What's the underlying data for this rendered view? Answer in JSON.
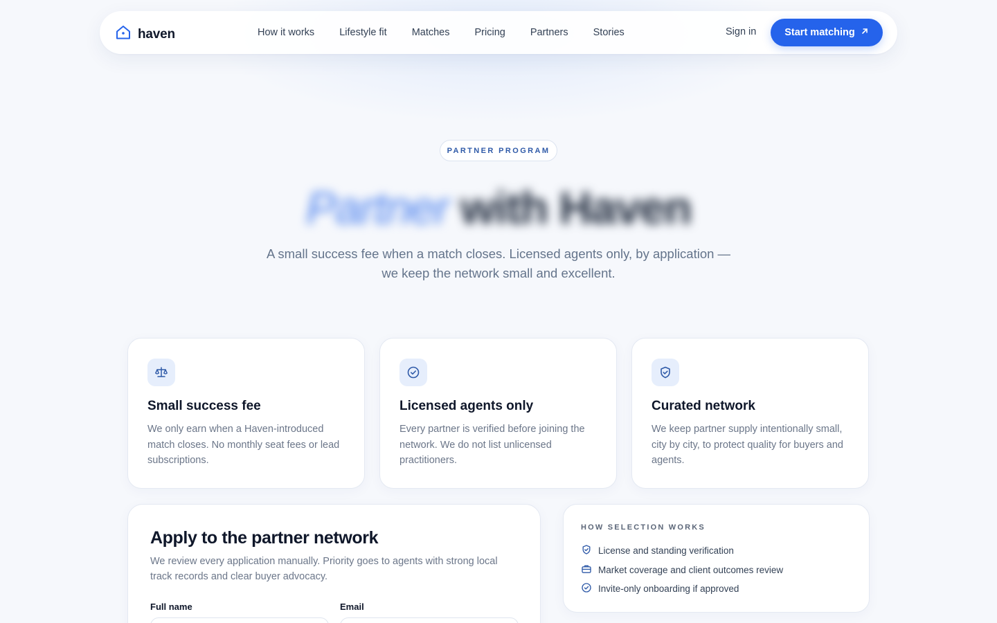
{
  "nav": {
    "brand": "haven",
    "links": [
      "How it works",
      "Lifestyle fit",
      "Matches",
      "Pricing",
      "Partners",
      "Stories"
    ],
    "signin": "Sign in",
    "cta": "Start matching"
  },
  "hero": {
    "eyebrow": "PARTNER PROGRAM",
    "title_accent": "Partner",
    "title_rest": "with Haven",
    "subtitle_line1": "A small success fee when a match closes. Licensed agents only, by application —",
    "subtitle_line2": "we keep the network small and excellent."
  },
  "features": [
    {
      "icon": "scale-icon",
      "title": "Small success fee",
      "body": "We only earn when a Haven-introduced match closes. No monthly seat fees or lead subscriptions."
    },
    {
      "icon": "badge-check-icon",
      "title": "Licensed agents only",
      "body": "Every partner is verified before joining the network. We do not list unlicensed practitioners."
    },
    {
      "icon": "shield-check-icon",
      "title": "Curated network",
      "body": "We keep partner supply intentionally small, city by city, to protect quality for buyers and agents."
    }
  ],
  "apply": {
    "title": "Apply to the partner network",
    "body": "We review every application manually. Priority goes to agents with strong local track records and clear buyer advocacy.",
    "full_name_label": "Full name",
    "email_label": "Email"
  },
  "selection": {
    "label": "HOW SELECTION WORKS",
    "items": [
      {
        "icon": "shield-check-icon",
        "text": "License and standing verification"
      },
      {
        "icon": "briefcase-icon",
        "text": "Market coverage and client outcomes review"
      },
      {
        "icon": "circle-check-icon",
        "text": "Invite-only onboarding if approved"
      }
    ]
  },
  "colors": {
    "accent": "#2563eb",
    "background": "#f6f8fc",
    "text": "#0f172a",
    "muted": "#64748b"
  }
}
